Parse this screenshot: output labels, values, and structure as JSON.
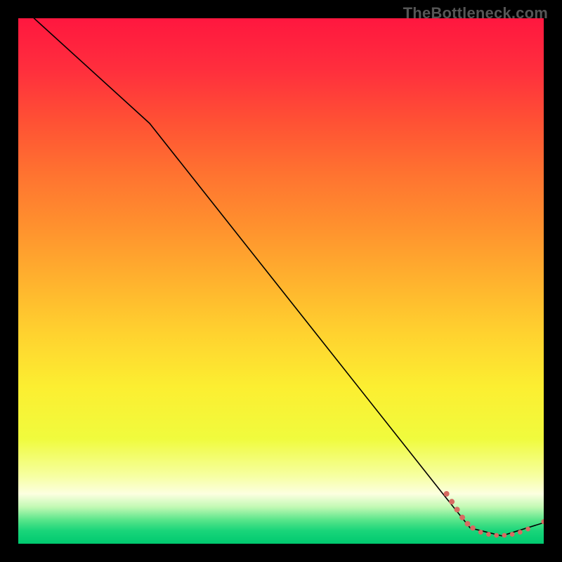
{
  "watermark": "TheBottleneck.com",
  "gradient": {
    "stops": [
      {
        "offset": 0.0,
        "color": "#ff173f"
      },
      {
        "offset": 0.1,
        "color": "#ff2f3d"
      },
      {
        "offset": 0.2,
        "color": "#ff5234"
      },
      {
        "offset": 0.3,
        "color": "#ff7430"
      },
      {
        "offset": 0.4,
        "color": "#ff922e"
      },
      {
        "offset": 0.5,
        "color": "#ffb22e"
      },
      {
        "offset": 0.6,
        "color": "#ffd22f"
      },
      {
        "offset": 0.7,
        "color": "#fcee31"
      },
      {
        "offset": 0.8,
        "color": "#f0fb3d"
      },
      {
        "offset": 0.87,
        "color": "#f6ffa0"
      },
      {
        "offset": 0.905,
        "color": "#fcffe0"
      },
      {
        "offset": 0.93,
        "color": "#c2f9b4"
      },
      {
        "offset": 0.955,
        "color": "#58e58a"
      },
      {
        "offset": 0.975,
        "color": "#1ad57a"
      },
      {
        "offset": 1.0,
        "color": "#00c96f"
      }
    ]
  },
  "chart_data": {
    "type": "line",
    "title": "",
    "xlabel": "",
    "ylabel": "",
    "xlim": [
      0,
      100
    ],
    "ylim": [
      0,
      100
    ],
    "series": [
      {
        "name": "curve",
        "x": [
          3,
          25,
          82,
          86,
          92,
          100
        ],
        "y": [
          100,
          80,
          8,
          3,
          1.5,
          4
        ],
        "stroke": "#000000",
        "width": 1.6
      }
    ],
    "markers": {
      "name": "dots",
      "color": "#d76b62",
      "points": [
        {
          "x": 81.5,
          "y": 9.5,
          "r": 4.0
        },
        {
          "x": 82.5,
          "y": 8.0,
          "r": 4.0
        },
        {
          "x": 83.5,
          "y": 6.5,
          "r": 4.0
        },
        {
          "x": 84.5,
          "y": 5.0,
          "r": 4.0
        },
        {
          "x": 85.5,
          "y": 3.8,
          "r": 4.0
        },
        {
          "x": 86.5,
          "y": 3.0,
          "r": 3.8
        },
        {
          "x": 88.0,
          "y": 2.2,
          "r": 3.4
        },
        {
          "x": 89.5,
          "y": 1.8,
          "r": 3.4
        },
        {
          "x": 91.0,
          "y": 1.6,
          "r": 3.4
        },
        {
          "x": 92.5,
          "y": 1.6,
          "r": 3.4
        },
        {
          "x": 94.0,
          "y": 1.8,
          "r": 3.4
        },
        {
          "x": 95.5,
          "y": 2.2,
          "r": 3.4
        },
        {
          "x": 97.0,
          "y": 2.8,
          "r": 3.4
        },
        {
          "x": 100.0,
          "y": 4.2,
          "r": 3.6
        }
      ]
    }
  }
}
